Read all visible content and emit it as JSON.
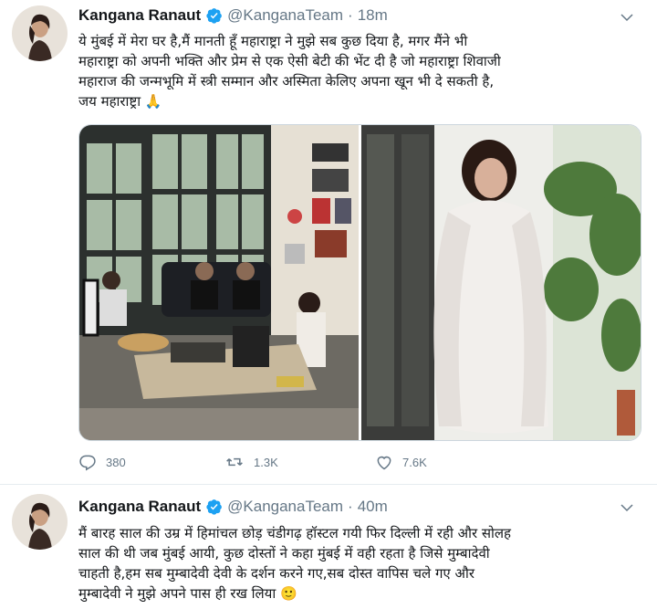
{
  "tweets": [
    {
      "name": "Kangana Ranaut",
      "handle": "@KanganaTeam",
      "separator": "·",
      "time": "18m",
      "text": "ये मुंबई में मेरा घर है,मैं मानती हूँ महाराष्ट्रा ने मुझे सब कुछ दिया है, मगर मैंने भी\nमहाराष्ट्रा को अपनी भक्ति और प्रेम से एक ऐसी बेटी की भेंट दी है जो महाराष्ट्रा शिवाजी\nमहाराज की जन्मभूमि में स्त्री सम्मान और अस्मिता केलिए अपना खून भी दे सकती है,\nजय महाराष्ट्रा 🙏",
      "replies": "380",
      "retweets": "1.3K",
      "likes": "7.6K"
    },
    {
      "name": "Kangana Ranaut",
      "handle": "@KanganaTeam",
      "separator": "·",
      "time": "40m",
      "text": "मैं बारह साल की उम्र में हिमांचल छोड़ चंडीगढ़ हॉस्टल गयी फिर दिल्ली में रही और सोलह\nसाल की थी जब मुंबई आयी, कुछ दोस्तों ने कहा मुंबई में वही रहता है जिसे मुम्बादेवी\nचाहती है,हम सब मुम्बादेवी देवी के दर्शन करने गए,सब दोस्त वापिस चले गए और\nमुम्बादेवी ने मुझे अपने पास ही रख लिया 🙂"
    }
  ],
  "colors": {
    "verified": "#1da1f2",
    "secondary": "#657786",
    "text": "#14171a"
  },
  "icons": [
    "verified-badge-icon",
    "chevron-down-icon",
    "reply-icon",
    "retweet-icon",
    "like-icon"
  ]
}
